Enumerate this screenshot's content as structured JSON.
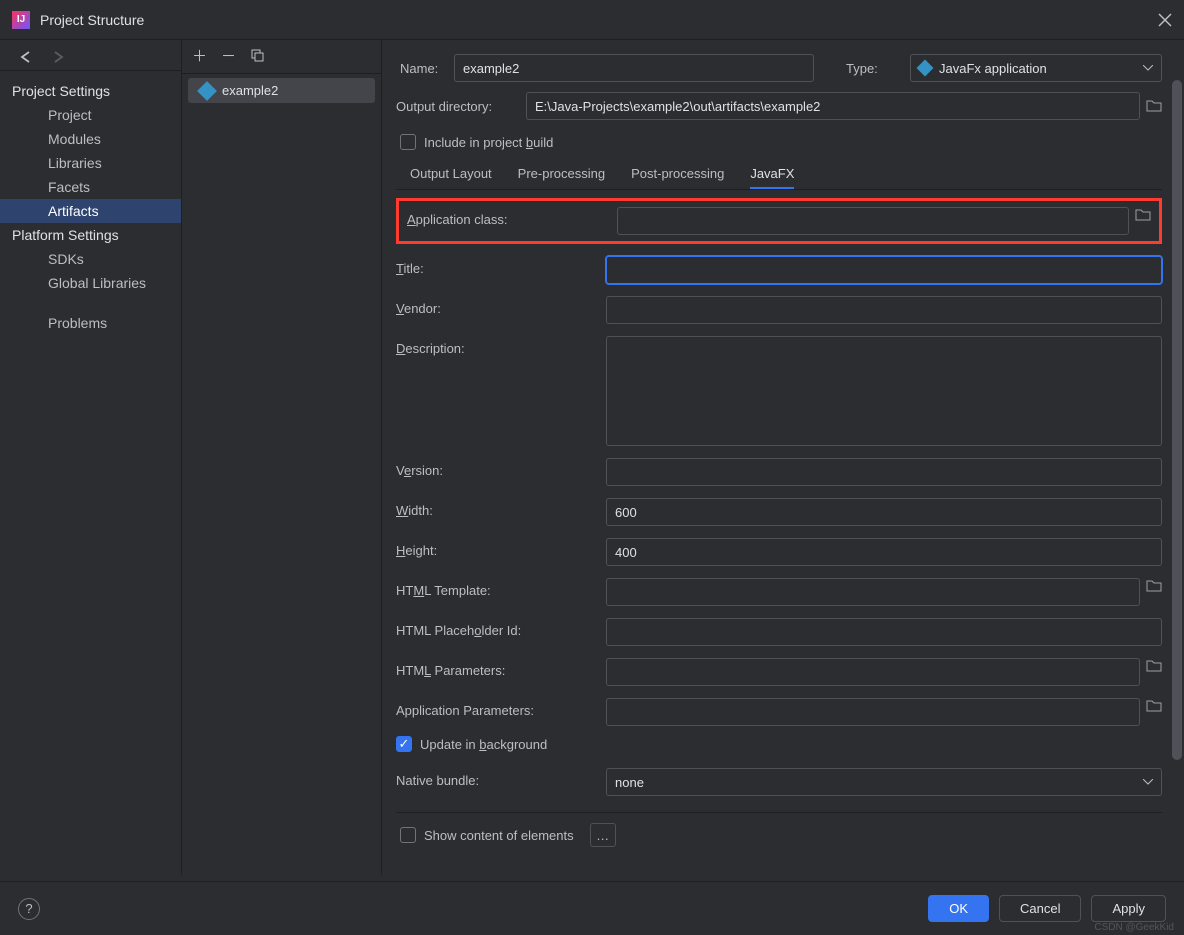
{
  "window": {
    "title": "Project Structure"
  },
  "sidebar": {
    "project_settings_label": "Project Settings",
    "project": "Project",
    "modules": "Modules",
    "libraries": "Libraries",
    "facets": "Facets",
    "artifacts": "Artifacts",
    "platform_settings_label": "Platform Settings",
    "sdks": "SDKs",
    "global_libraries": "Global Libraries",
    "problems": "Problems"
  },
  "artifacts_list": {
    "selected": "example2"
  },
  "form": {
    "name_label": "Name:",
    "name_value": "example2",
    "type_label": "Type:",
    "type_value": "JavaFx application",
    "output_dir_label": "Output directory:",
    "output_dir_value": "E:\\Java-Projects\\example2\\out\\artifacts\\example2",
    "include_build_label_pre": "Include in project ",
    "include_build_label_u": "b",
    "include_build_label_post": "uild"
  },
  "tabs": {
    "output_layout": "Output Layout",
    "pre_processing": "Pre-processing",
    "post_processing": "Post-processing",
    "javafx": "JavaFX"
  },
  "javafx": {
    "app_class_label_u": "A",
    "app_class_label_post": "pplication class:",
    "app_class_value": "",
    "title_label_u": "T",
    "title_label_post": "itle:",
    "title_value": "",
    "vendor_label_u": "V",
    "vendor_label_post": "endor:",
    "vendor_value": "",
    "description_label_u": "D",
    "description_label_post": "escription:",
    "description_value": "",
    "version_label_pre": "V",
    "version_label_u": "e",
    "version_label_post": "rsion:",
    "version_value": "",
    "width_label_u": "W",
    "width_label_post": "idth:",
    "width_value": "600",
    "height_label_u": "H",
    "height_label_post": "eight:",
    "height_value": "400",
    "html_template_label_pre": "HT",
    "html_template_label_u": "M",
    "html_template_label_post": "L Template:",
    "html_template_value": "",
    "html_placeholder_label_pre": "HTML Placeh",
    "html_placeholder_label_u": "o",
    "html_placeholder_label_post": "lder Id:",
    "html_placeholder_value": "",
    "html_params_label_pre": "HTM",
    "html_params_label_u": "L",
    "html_params_label_post": " Parameters:",
    "html_params_value": "",
    "app_params_label": "Application Parameters:",
    "app_params_value": "",
    "update_bg_pre": "Update in ",
    "update_bg_u": "b",
    "update_bg_post": "ackground",
    "native_bundle_label": "Native bundle:",
    "native_bundle_value": "none",
    "show_content_label": "Show content of elements",
    "ellipsis": "…"
  },
  "footer": {
    "ok": "OK",
    "cancel": "Cancel",
    "apply": "Apply",
    "help": "?"
  },
  "watermark": "CSDN @GeekKid"
}
